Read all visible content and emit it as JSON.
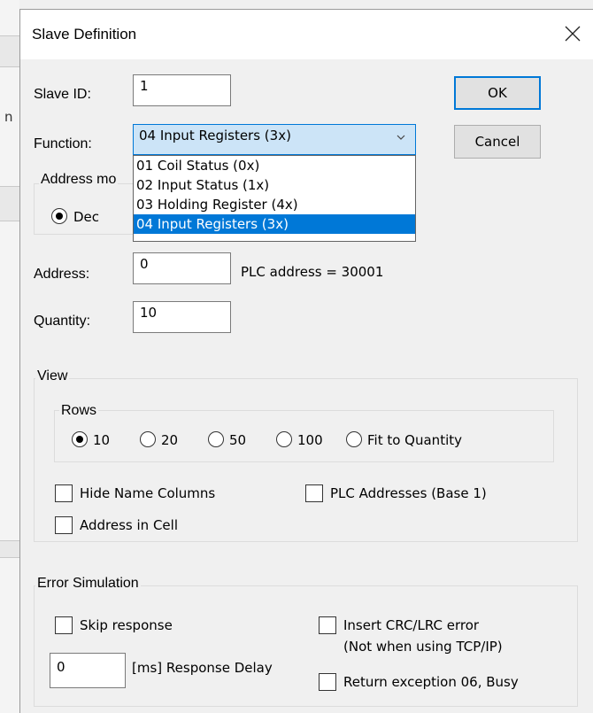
{
  "background": {
    "partial_char": "n"
  },
  "dialog": {
    "title": "Slave Definition",
    "slave_id": {
      "label": "Slave ID:",
      "value": "1"
    },
    "function": {
      "label": "Function:",
      "selected": "04 Input Registers (3x)",
      "options": [
        "01 Coil Status (0x)",
        "02 Input Status (1x)",
        "03 Holding Register (4x)",
        "04 Input Registers (3x)"
      ]
    },
    "address_mode": {
      "title": "Address mo",
      "dec_label": "Dec"
    },
    "address": {
      "label": "Address:",
      "value": "0",
      "plc_address": "PLC address = 30001"
    },
    "quantity": {
      "label": "Quantity:",
      "value": "10"
    },
    "buttons": {
      "ok": "OK",
      "cancel": "Cancel"
    },
    "view": {
      "title": "View",
      "rows_title": "Rows",
      "rows": [
        "10",
        "20",
        "50",
        "100",
        "Fit to Quantity"
      ],
      "rows_selected": "10",
      "hide_name_columns": "Hide Name Columns",
      "plc_addresses": "PLC Addresses (Base 1)",
      "address_in_cell": "Address in Cell"
    },
    "error_simulation": {
      "title": "Error Simulation",
      "skip_response": "Skip response",
      "insert_crc_line1": "Insert CRC/LRC error",
      "insert_crc_line2": "(Not when using TCP/IP)",
      "response_delay_value": "0",
      "response_delay_label": "[ms] Response Delay",
      "return_exception": "Return exception 06, Busy"
    }
  },
  "colors": {
    "accent": "#0078d7",
    "dropdown_selected_bg": "#0078d7",
    "select_bg": "#cce4f7"
  }
}
